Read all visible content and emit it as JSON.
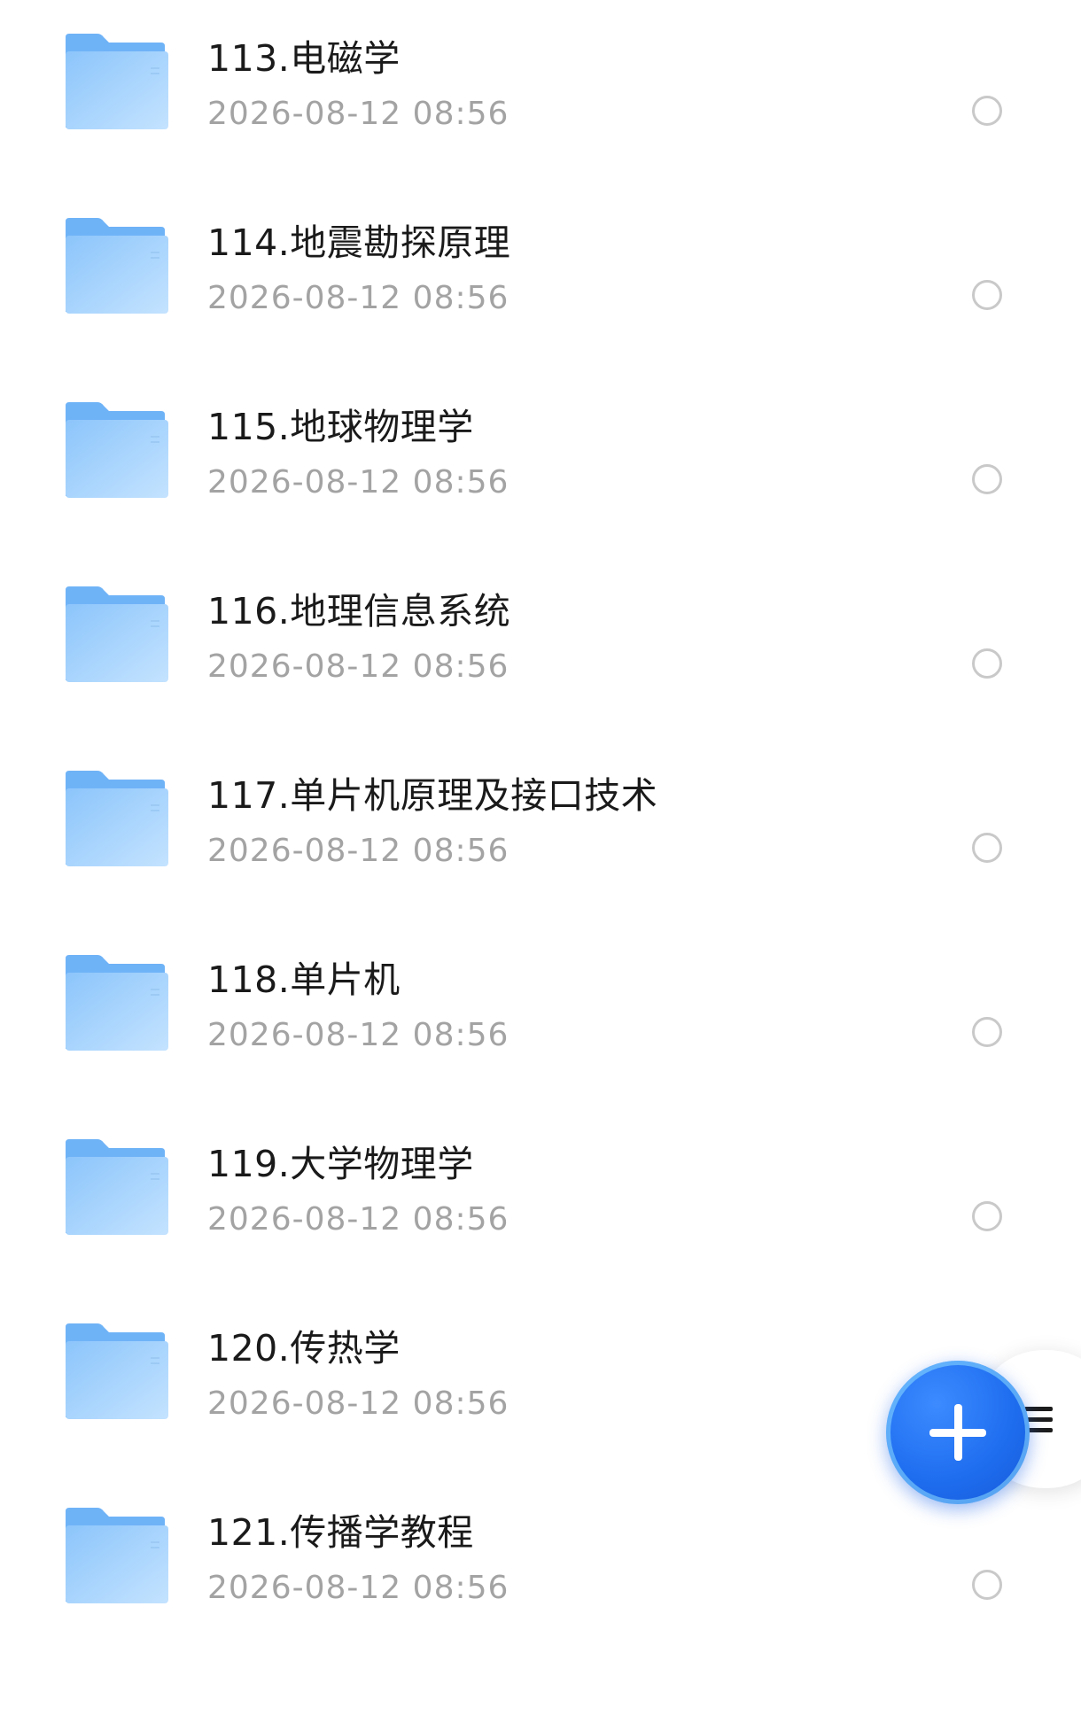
{
  "files": [
    {
      "name": "113.电磁学",
      "date": "2026-08-12 08:56"
    },
    {
      "name": "114.地震勘探原理",
      "date": "2026-08-12 08:56"
    },
    {
      "name": "115.地球物理学",
      "date": "2026-08-12 08:56"
    },
    {
      "name": "116.地理信息系统",
      "date": "2026-08-12 08:56"
    },
    {
      "name": "117.单片机原理及接口技术",
      "date": "2026-08-12 08:56"
    },
    {
      "name": "118.单片机",
      "date": "2026-08-12 08:56"
    },
    {
      "name": "119.大学物理学",
      "date": "2026-08-12 08:56"
    },
    {
      "name": "120.传热学",
      "date": "2026-08-12 08:56"
    },
    {
      "name": "121.传播学教程",
      "date": "2026-08-12 08:56"
    }
  ],
  "icons": {
    "folder": "folder-icon",
    "select": "radio-circle-icon",
    "fab": "plus-icon",
    "menu": "menu-bars-icon"
  },
  "colors": {
    "folder_light": "#bfe0ff",
    "folder_dark": "#6fb3f7",
    "fab": "#1f6ef0",
    "date_text": "#a3a3a3"
  }
}
